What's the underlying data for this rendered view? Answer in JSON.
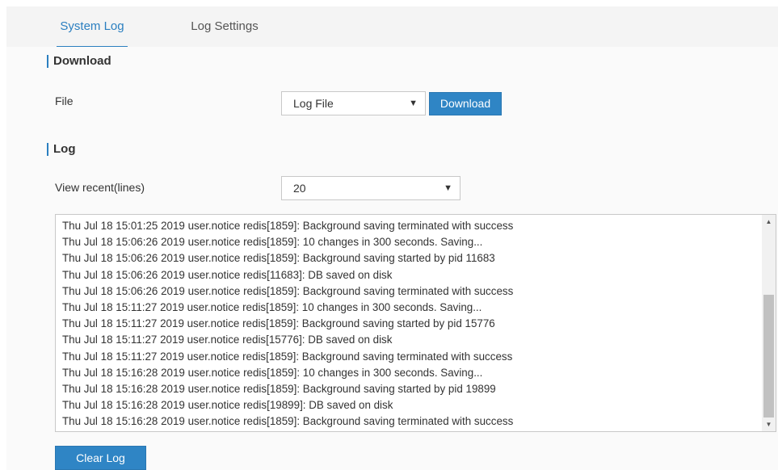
{
  "tabs": [
    {
      "label": "System Log",
      "active": true
    },
    {
      "label": "Log Settings",
      "active": false
    }
  ],
  "download": {
    "section_title": "Download",
    "file_label": "File",
    "file_select_value": "Log File",
    "download_button": "Download"
  },
  "log": {
    "section_title": "Log",
    "view_recent_label": "View recent(lines)",
    "view_recent_value": "20",
    "lines": [
      "Thu Jul 18 15:01:25 2019 user.notice redis[1859]: Background saving terminated with success",
      "Thu Jul 18 15:06:26 2019 user.notice redis[1859]: 10 changes in 300 seconds. Saving...",
      "Thu Jul 18 15:06:26 2019 user.notice redis[1859]: Background saving started by pid 11683",
      "Thu Jul 18 15:06:26 2019 user.notice redis[11683]: DB saved on disk",
      "Thu Jul 18 15:06:26 2019 user.notice redis[1859]: Background saving terminated with success",
      "Thu Jul 18 15:11:27 2019 user.notice redis[1859]: 10 changes in 300 seconds. Saving...",
      "Thu Jul 18 15:11:27 2019 user.notice redis[1859]: Background saving started by pid 15776",
      "Thu Jul 18 15:11:27 2019 user.notice redis[15776]: DB saved on disk",
      "Thu Jul 18 15:11:27 2019 user.notice redis[1859]: Background saving terminated with success",
      "Thu Jul 18 15:16:28 2019 user.notice redis[1859]: 10 changes in 300 seconds. Saving...",
      "Thu Jul 18 15:16:28 2019 user.notice redis[1859]: Background saving started by pid 19899",
      "Thu Jul 18 15:16:28 2019 user.notice redis[19899]: DB saved on disk",
      "Thu Jul 18 15:16:28 2019 user.notice redis[1859]: Background saving terminated with success"
    ],
    "clear_button": "Clear Log"
  },
  "icons": {
    "select_caret": "chevron-down-icon",
    "scroll_up": "arrow-up-icon",
    "scroll_down": "arrow-down-icon"
  },
  "colors": {
    "accent": "#2b7fc0",
    "button_bg": "#2f85c5"
  }
}
